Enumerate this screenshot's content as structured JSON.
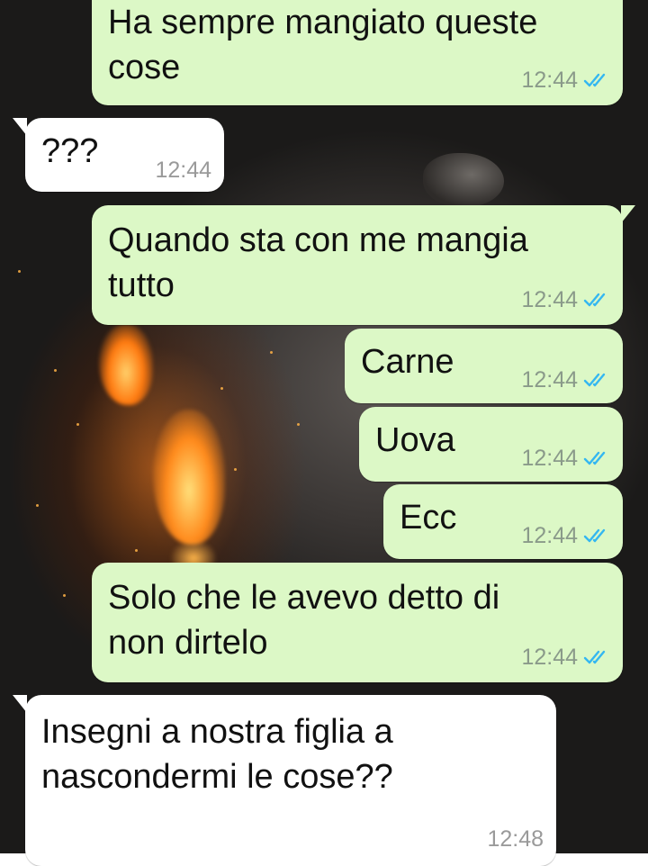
{
  "chat": {
    "messages": [
      {
        "direction": "outgoing",
        "text": "Ha sempre mangiato queste\ncose",
        "time": "12:44",
        "status": "read-double-check-icon"
      },
      {
        "direction": "incoming",
        "text": "???",
        "time": "12:44"
      },
      {
        "direction": "outgoing",
        "text": "Quando sta con me mangia\ntutto",
        "time": "12:44",
        "status": "read-double-check-icon"
      },
      {
        "direction": "outgoing",
        "text": "Carne",
        "time": "12:44",
        "status": "read-double-check-icon"
      },
      {
        "direction": "outgoing",
        "text": "Uova",
        "time": "12:44",
        "status": "read-double-check-icon"
      },
      {
        "direction": "outgoing",
        "text": "Ecc",
        "time": "12:44",
        "status": "read-double-check-icon"
      },
      {
        "direction": "outgoing",
        "text": "Solo che le avevo detto di\nnon dirtelo",
        "time": "12:44",
        "status": "read-double-check-icon"
      },
      {
        "direction": "incoming",
        "text": "Insegni a nostra figlia a\nnascondermi le cose??",
        "time": "12:48"
      }
    ]
  },
  "colors": {
    "outgoing_bubble": "#dcf8c6",
    "incoming_bubble": "#ffffff",
    "read_ticks": "#34b7f1"
  }
}
